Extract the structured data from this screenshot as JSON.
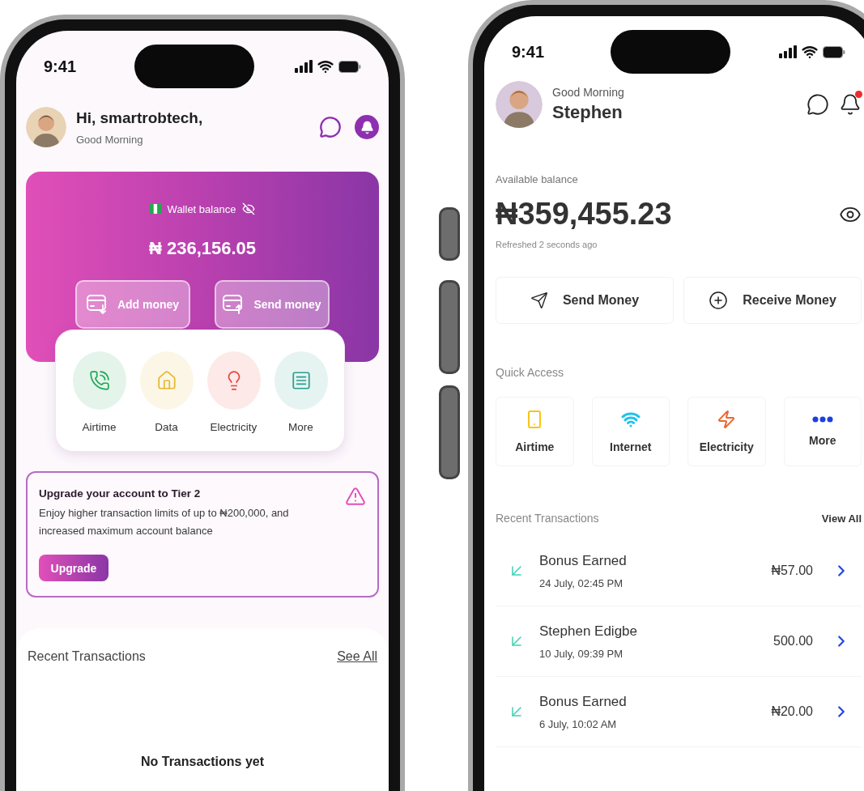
{
  "left_phone": {
    "status_bar": {
      "time": "9:41"
    },
    "header": {
      "greeting": "Hi, smartrobtech,",
      "subtitle": "Good Morning"
    },
    "wallet_card": {
      "label": "Wallet balance",
      "amount": "₦ 236,156.05",
      "buttons": [
        {
          "label": "Add money",
          "kind": "add"
        },
        {
          "label": "Send money",
          "kind": "send"
        }
      ]
    },
    "services": [
      {
        "label": "Airtime",
        "kind": "airtime",
        "color": "#1fa855"
      },
      {
        "label": "Data",
        "kind": "data",
        "color": "#e6b82e"
      },
      {
        "label": "Electricity",
        "kind": "electricity",
        "color": "#e5493f"
      },
      {
        "label": "More",
        "kind": "more",
        "color": "#2a9d8f"
      }
    ],
    "upgrade_banner": {
      "title": "Upgrade your account to Tier 2",
      "body": "Enjoy higher transaction limits of up to ₦200,000, and increased maximum account balance",
      "button": "Upgrade"
    },
    "recent_transactions": {
      "title": "Recent Transactions",
      "link": "See All",
      "empty_text": "No Transactions yet"
    }
  },
  "right_phone": {
    "status_bar": {
      "time": "9:41"
    },
    "header": {
      "greeting": "Good Morning",
      "name": "Stephen",
      "has_unread": true
    },
    "balance": {
      "label": "Available balance",
      "amount": "₦359,455.23",
      "refreshed": "Refreshed 2 seconds ago"
    },
    "actions": [
      {
        "label": "Send Money",
        "kind": "send"
      },
      {
        "label": "Receive Money",
        "kind": "receive"
      }
    ],
    "quick_access": {
      "title": "Quick Access",
      "items": [
        {
          "label": "Airtime",
          "kind": "airtime",
          "color": "#f5c518"
        },
        {
          "label": "Internet",
          "kind": "internet",
          "color": "#1ec3ef"
        },
        {
          "label": "Electricity",
          "kind": "electricity",
          "color": "#f0642a"
        },
        {
          "label": "More",
          "kind": "more",
          "color": "#1d3fe0"
        }
      ]
    },
    "recent_transactions": {
      "title": "Recent Transactions",
      "link": "View All",
      "rows": [
        {
          "name": "Bonus Earned",
          "date": "24 July, 02:45 PM",
          "amount": "₦57.00"
        },
        {
          "name": "Stephen Edigbe",
          "date": "10 July, 09:39 PM",
          "amount": "500.00"
        },
        {
          "name": "Bonus Earned",
          "date": "6 July, 10:02 AM",
          "amount": "₦20.00"
        }
      ]
    }
  }
}
